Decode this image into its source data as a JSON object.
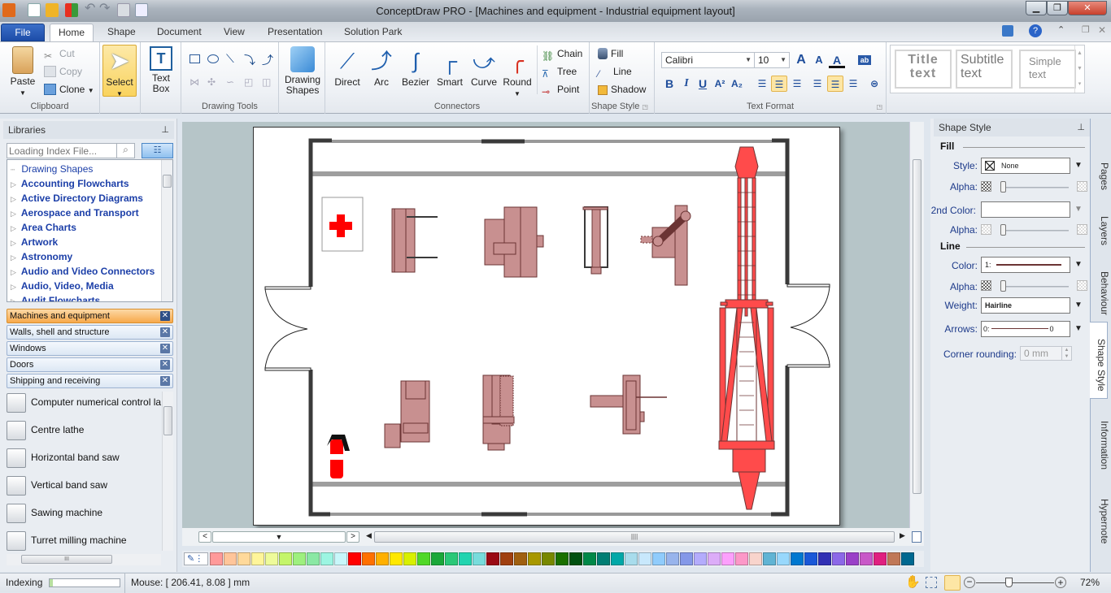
{
  "window": {
    "title": "ConceptDraw PRO - [Machines and equipment - Industrial equipment layout]",
    "controls": [
      "minimize",
      "restore",
      "close"
    ]
  },
  "quick_access": [
    "new-document",
    "open-folder",
    "solution-browser",
    "undo",
    "redo",
    "save",
    "print-preview"
  ],
  "menu_tabs": [
    {
      "label": "File",
      "active": false
    },
    {
      "label": "Home",
      "active": true
    },
    {
      "label": "Shape",
      "active": false
    },
    {
      "label": "Document",
      "active": false
    },
    {
      "label": "View",
      "active": false
    },
    {
      "label": "Presentation",
      "active": false
    },
    {
      "label": "Solution Park",
      "active": false
    }
  ],
  "ribbon": {
    "clipboard": {
      "label": "Clipboard",
      "paste": "Paste",
      "cut": "Cut",
      "copy": "Copy",
      "clone": "Clone"
    },
    "select": {
      "label": "Select"
    },
    "textbox": {
      "label1": "Text",
      "label2": "Box"
    },
    "drawing_tools": {
      "label": "Drawing Tools"
    },
    "drawing_shapes": {
      "label1": "Drawing",
      "label2": "Shapes"
    },
    "connectors": {
      "label": "Connectors",
      "items": [
        "Direct",
        "Arc",
        "Bezier",
        "Smart",
        "Curve",
        "Round"
      ],
      "chain": "Chain",
      "tree": "Tree",
      "point": "Point"
    },
    "shape_style": {
      "label": "Shape Style",
      "fill": "Fill",
      "line": "Line",
      "shadow": "Shadow"
    },
    "text_format": {
      "label": "Text Format",
      "font": "Calibri",
      "size": "10",
      "bold": "B",
      "italic": "I",
      "underline": "U"
    },
    "styles": {
      "title1": "Title",
      "title2": "text",
      "subtitle1": "Subtitle",
      "subtitle2": "text",
      "simple1": "Simple",
      "simple2": "text"
    }
  },
  "libraries": {
    "header": "Libraries",
    "search_placeholder": "Loading Index File...",
    "tree": [
      "Drawing Shapes",
      "Accounting Flowcharts",
      "Active Directory Diagrams",
      "Aerospace and Transport",
      "Area Charts",
      "Artwork",
      "Astronomy",
      "Audio and Video Connectors",
      "Audio, Video, Media",
      "Audit Flowcharts"
    ],
    "open_libraries": [
      {
        "label": "Machines and equipment",
        "active": true
      },
      {
        "label": "Walls, shell and structure",
        "active": false
      },
      {
        "label": "Windows",
        "active": false
      },
      {
        "label": "Doors",
        "active": false
      },
      {
        "label": "Shipping and receiving",
        "active": false
      }
    ],
    "shapes": [
      "Computer numerical control la",
      "Centre lathe",
      "Horizontal band saw",
      "Vertical band saw",
      "Sawing machine",
      "Turret milling machine"
    ]
  },
  "shape_style_panel": {
    "header": "Shape Style",
    "fill_section": "Fill",
    "style_label": "Style:",
    "style_value": "None",
    "alpha_label": "Alpha:",
    "second_color_label": "2nd Color:",
    "line_section": "Line",
    "color_label": "Color:",
    "color_value": "1:",
    "weight_label": "Weight:",
    "weight_value": "Hairline",
    "arrows_label": "Arrows:",
    "arrows_left": "0:",
    "arrows_right": "0",
    "corner_label": "Corner rounding:",
    "corner_value": "0 mm",
    "fill_alpha": 0,
    "second_alpha": 0,
    "line_alpha": 0
  },
  "side_tabs": [
    {
      "label": "Pages",
      "active": false
    },
    {
      "label": "Layers",
      "active": false
    },
    {
      "label": "Behaviour",
      "active": false
    },
    {
      "label": "Shape Style",
      "active": true
    },
    {
      "label": "Information",
      "active": false
    },
    {
      "label": "Hypernote",
      "active": false
    }
  ],
  "palette": [
    "#ff9a9a",
    "#ffc59a",
    "#ffd99a",
    "#fff59a",
    "#eefb9a",
    "#c4f56a",
    "#9ef07e",
    "#8ae8a4",
    "#9cf5e2",
    "#c8f7fa",
    "#ff0000",
    "#ff7000",
    "#ffb000",
    "#ffe800",
    "#d8f000",
    "#50d828",
    "#1aa83a",
    "#2ac878",
    "#22d4b0",
    "#78dcdc",
    "#9a0a14",
    "#a04010",
    "#a06010",
    "#a89800",
    "#788800",
    "#1a7000",
    "#005010",
    "#008848",
    "#007e74",
    "#00a8a8",
    "#a8dcec",
    "#c8e8fc",
    "#90ccfc",
    "#98b4ec",
    "#8498e8",
    "#b4acfc",
    "#dcacf8",
    "#fca0fc",
    "#fc98c8",
    "#f8d4cc",
    "#60b4d4",
    "#98d8fc",
    "#0078d0",
    "#1a58d8",
    "#3030b4",
    "#8c68e8",
    "#9a40c8",
    "#c858c8",
    "#e02080",
    "#c07858",
    "#006890"
  ],
  "status": {
    "indexing_label": "Indexing",
    "indexing_progress": 0.05,
    "mouse": "Mouse: [ 206.41, 8.08 ] mm",
    "zoom": "72%",
    "zoom_level": 0.72
  },
  "diagram": {
    "colors": {
      "machine": "#c89090",
      "machine_stroke": "#6b3434",
      "crane": "#ff4b4b",
      "wall": "#3a3a3a",
      "rail": "#9e9e9e"
    },
    "objects": [
      "first-aid-sign",
      "lathe",
      "cnc-machine",
      "vertical-band-saw",
      "radial-drill",
      "jib-crane",
      "fire-extinguisher",
      "milling-machine",
      "turret-mill",
      "horizontal-borer",
      "left-double-door",
      "right-double-door"
    ]
  }
}
